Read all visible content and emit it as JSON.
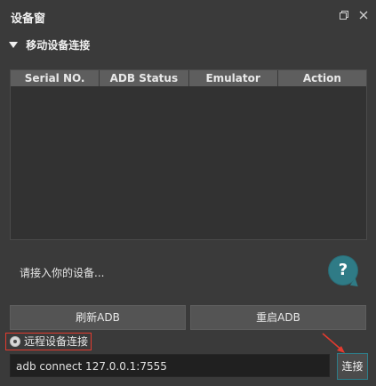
{
  "window": {
    "title": "设备窗"
  },
  "section": {
    "title": "移动设备连接"
  },
  "table": {
    "headers": [
      "Serial NO.",
      "ADB Status",
      "Emulator",
      "Action"
    ],
    "rows": []
  },
  "hint": {
    "text": "请接入你的设备..."
  },
  "help": {
    "label": "?"
  },
  "buttons": {
    "refresh": "刷新ADB",
    "restart": "重启ADB"
  },
  "remote": {
    "label": "远程设备连接",
    "selected": true
  },
  "connect": {
    "input_value": "adb connect 127.0.0.1:7555",
    "button_label": "连接"
  },
  "colors": {
    "background": "#3a3a3a",
    "header": "#5e5e5e",
    "highlight": "#e33b2f",
    "accent": "#2f7b86"
  }
}
